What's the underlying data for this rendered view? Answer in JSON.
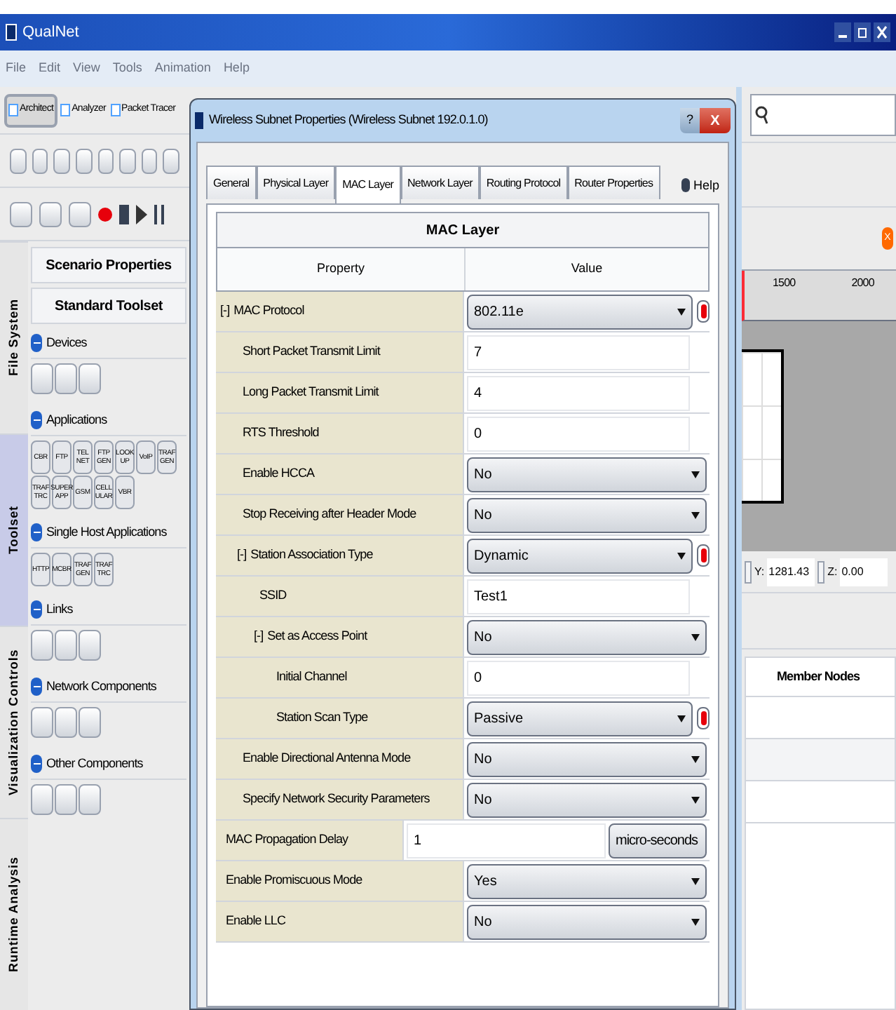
{
  "app_window": {
    "title": "QualNet",
    "menu": [
      "File",
      "Edit",
      "View",
      "Tools",
      "Animation",
      "Help"
    ]
  },
  "perspectives": [
    {
      "label": "Architect",
      "selected": true
    },
    {
      "label": "Analyzer",
      "selected": false
    },
    {
      "label": "Packet Tracer",
      "selected": false
    }
  ],
  "side_tabs": [
    {
      "label": "File System",
      "selected": false
    },
    {
      "label": "Toolset",
      "selected": true
    },
    {
      "label": "Visualization Controls",
      "selected": false
    },
    {
      "label": "Runtime Analysis",
      "selected": false
    }
  ],
  "toolset": {
    "scenario_button": "Scenario Properties",
    "header": "Standard Toolset",
    "sections": [
      {
        "title": "Devices",
        "expanded": true
      },
      {
        "title": "Applications",
        "expanded": true,
        "tools": [
          "CBR",
          "FTP",
          "TEL NET",
          "FTP GEN",
          "LOOK UP",
          "VoIP",
          "TRAF GEN",
          "TRAF TRC",
          "SUPER APP",
          "GSM",
          "CELL ULAR",
          "VBR"
        ]
      },
      {
        "title": "Single Host Applications",
        "expanded": true,
        "tools": [
          "HTTP",
          "MCBR",
          "TRAF GEN",
          "TRAF TRC"
        ]
      },
      {
        "title": "Links",
        "expanded": true
      },
      {
        "title": "Network Components",
        "expanded": true
      },
      {
        "title": "Other Components",
        "expanded": true
      }
    ]
  },
  "dialog": {
    "title": "Wireless Subnet Properties (Wireless Subnet 192.0.1.0)",
    "help_button": "?",
    "close_button": "X",
    "help_link": "Help",
    "tabs": [
      {
        "label": "General",
        "selected": false
      },
      {
        "label": "Physical Layer",
        "selected": false
      },
      {
        "label": "MAC Layer",
        "selected": true
      },
      {
        "label": "Network Layer",
        "selected": false
      },
      {
        "label": "Routing Protocol",
        "selected": false
      },
      {
        "label": "Router Properties",
        "selected": false
      }
    ],
    "panel_title": "MAC Layer",
    "columns": [
      "Property",
      "Value"
    ],
    "properties": [
      {
        "toggle": "[-]",
        "name": "MAC Protocol",
        "kind": "select_reset",
        "value": "802.11e",
        "children": [
          {
            "name": "Short Packet Transmit Limit",
            "kind": "text",
            "value": "7"
          },
          {
            "name": "Long Packet Transmit Limit",
            "kind": "text",
            "value": "4"
          },
          {
            "name": "RTS Threshold",
            "kind": "text",
            "value": "0"
          },
          {
            "name": "Enable HCCA",
            "kind": "select",
            "value": "No"
          },
          {
            "name": "Stop Receiving after Header Mode",
            "kind": "select",
            "value": "No"
          },
          {
            "toggle": "[-]",
            "name": "Station Association Type",
            "kind": "select_reset",
            "value": "Dynamic",
            "children": [
              {
                "name": "SSID",
                "kind": "text",
                "value": "Test1"
              },
              {
                "toggle": "[-]",
                "name": "Set as Access Point",
                "kind": "select",
                "value": "No",
                "children": [
                  {
                    "name": "Initial Channel",
                    "kind": "text",
                    "value": "0"
                  },
                  {
                    "name": "Station Scan Type",
                    "kind": "select_reset",
                    "value": "Passive"
                  }
                ]
              }
            ]
          },
          {
            "name": "Enable Directional Antenna Mode",
            "kind": "select",
            "value": "No"
          },
          {
            "name": "Specify Network Security Parameters",
            "kind": "select",
            "value": "No"
          }
        ]
      },
      {
        "name": "MAC Propagation Delay",
        "kind": "unit",
        "value": "1",
        "unit": "micro-seconds"
      },
      {
        "name": "Enable Promiscuous Mode",
        "kind": "select",
        "value": "Yes"
      },
      {
        "name": "Enable LLC",
        "kind": "select",
        "value": "No"
      }
    ]
  },
  "canvas": {
    "ruler": [
      "1500",
      "2000"
    ],
    "coords": [
      {
        "label": "Y:",
        "value": "1281.43"
      },
      {
        "label": "Z:",
        "value": "0.00"
      }
    ],
    "close_badge": "X",
    "member_table": {
      "columns": [
        "Member Nodes"
      ]
    }
  }
}
